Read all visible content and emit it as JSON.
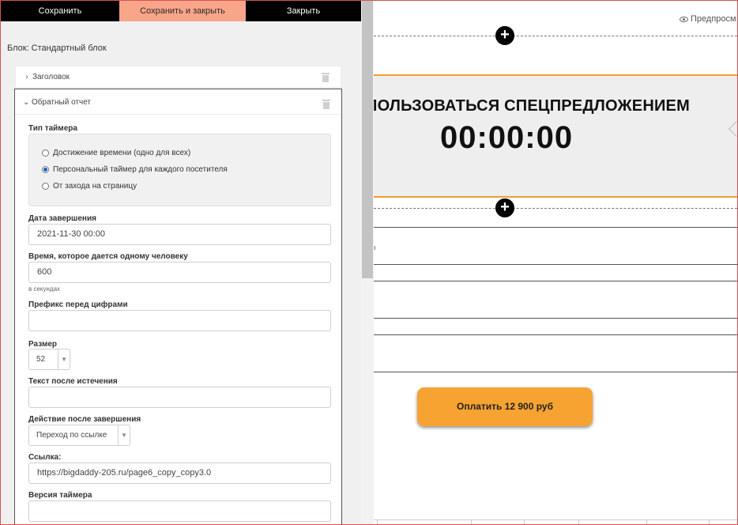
{
  "toolbar": {
    "save_label": "Сохранить",
    "save_close_label": "Сохранить и закрыть",
    "close_label": "Закрыть"
  },
  "block_title": "Блок: Стандартный блок",
  "sections": {
    "heading_label": "Заголовок",
    "countdown_label": "Обратный отчет"
  },
  "form": {
    "timer_type": {
      "label": "Тип таймера",
      "options": [
        "Достижение времени (одно для всех)",
        "Персональный таймер для каждого посетителя",
        "От захода на страницу"
      ],
      "selected": 1
    },
    "end_date": {
      "label": "Дата завершения",
      "value": "2021-11-30 00:00"
    },
    "time_per_person": {
      "label": "Время, которое дается одному человеку",
      "value": "600",
      "hint": "в секундах"
    },
    "prefix": {
      "label": "Префикс перед цифрами",
      "value": ""
    },
    "size": {
      "label": "Размер",
      "value": "52"
    },
    "after_text": {
      "label": "Текст после истечения",
      "value": ""
    },
    "after_action": {
      "label": "Действие после завершения",
      "value": "Переход по ссылке"
    },
    "link": {
      "label": "Ссылка:",
      "value": "https://bigdaddy-205.ru/page6_copy_copy3.0"
    },
    "version": {
      "label": "Версия таймера",
      "value": ""
    }
  },
  "preview": {
    "preview_label": "Предпросм",
    "timer_title": "ПОЛЬЗОВАТЬСЯ СПЕЦПРЕДЛОЖЕНИЕМ",
    "timer_value": "00:00:00",
    "stray_text": "ı",
    "pay_button": "Оплатить 12 900 руб"
  }
}
